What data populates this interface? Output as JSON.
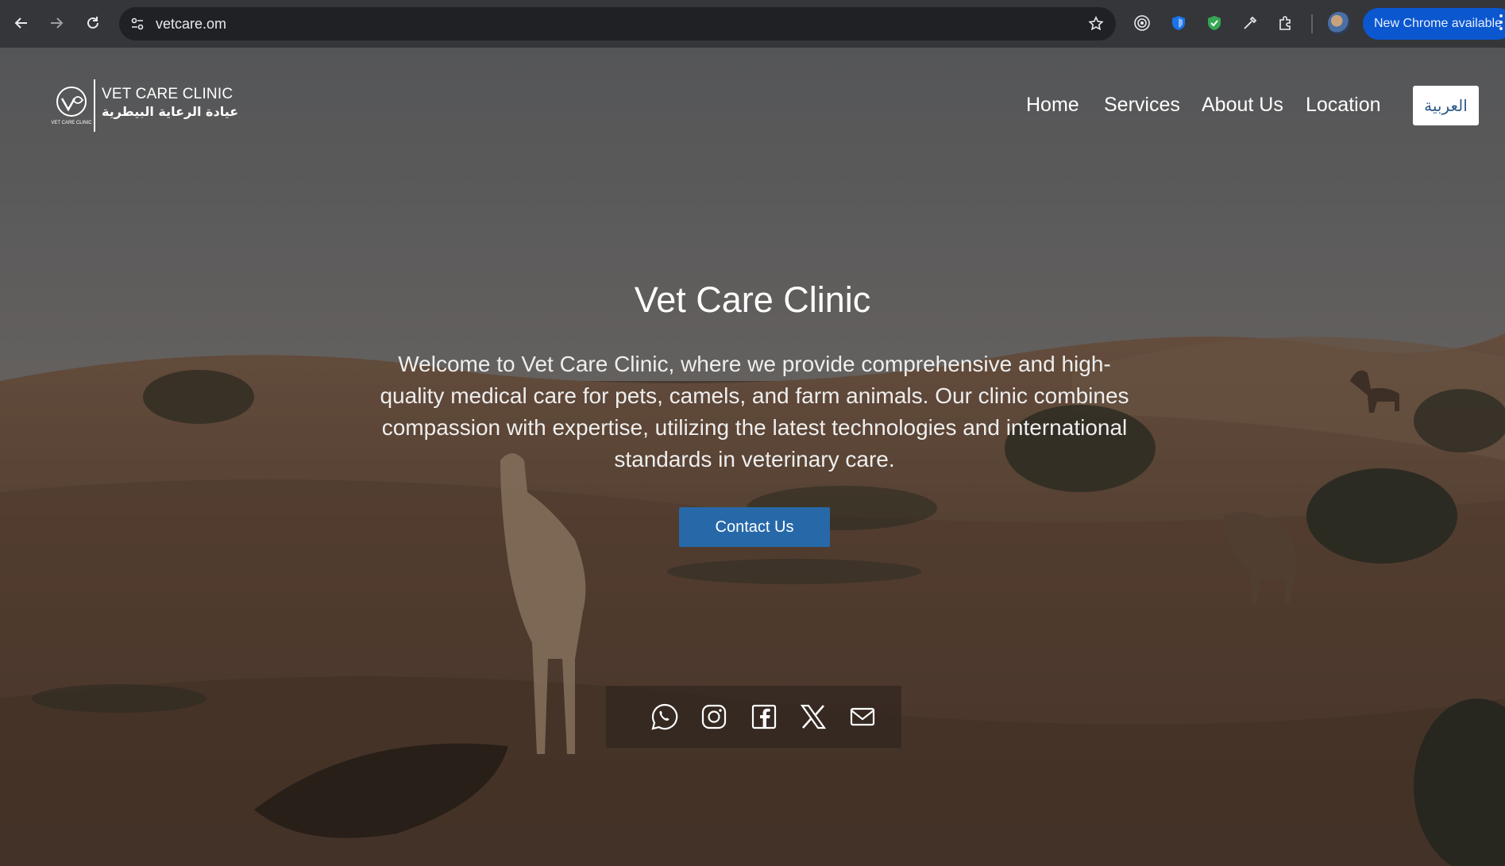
{
  "browser": {
    "url": "vetcare.om",
    "update_label": "New Chrome available"
  },
  "site": {
    "logo": {
      "name_en": "VET CARE CLINIC",
      "name_ar": "عيادة الرعاية البيطرية",
      "mark_text": "VET CARE CLINIC"
    },
    "nav": [
      {
        "label": "Home"
      },
      {
        "label": "Services"
      },
      {
        "label": "About Us"
      },
      {
        "label": "Location"
      }
    ],
    "lang_toggle": "العربية",
    "hero": {
      "title": "Vet Care Clinic",
      "text": "Welcome to Vet Care Clinic, where we provide comprehensive and high-quality medical care for pets, camels, and farm animals. Our clinic combines compassion with expertise, utilizing the latest technologies and international standards in veterinary care.",
      "cta": "Contact Us"
    },
    "social": [
      "whatsapp-icon",
      "instagram-icon",
      "facebook-icon",
      "x-icon",
      "email-icon"
    ]
  }
}
